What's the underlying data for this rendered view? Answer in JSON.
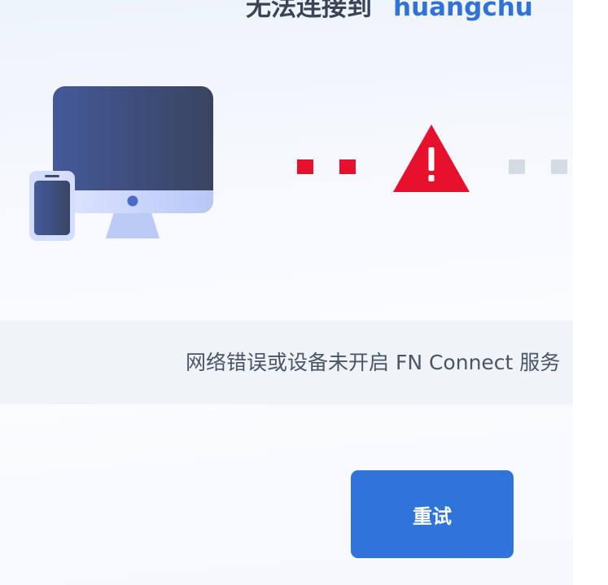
{
  "title": {
    "prefix": "无法连接到",
    "host": "huangchu"
  },
  "message": "网络错误或设备未开启 FN Connect 服务",
  "retry_label": "重试",
  "icons": {
    "device": "desktop-monitor-with-phone-icon",
    "warning": "warning-triangle-icon"
  },
  "colors": {
    "accent": "#2f74d8",
    "error": "#e8112d",
    "inactive_dot": "#d4dbe4",
    "title": "#3b4456"
  }
}
